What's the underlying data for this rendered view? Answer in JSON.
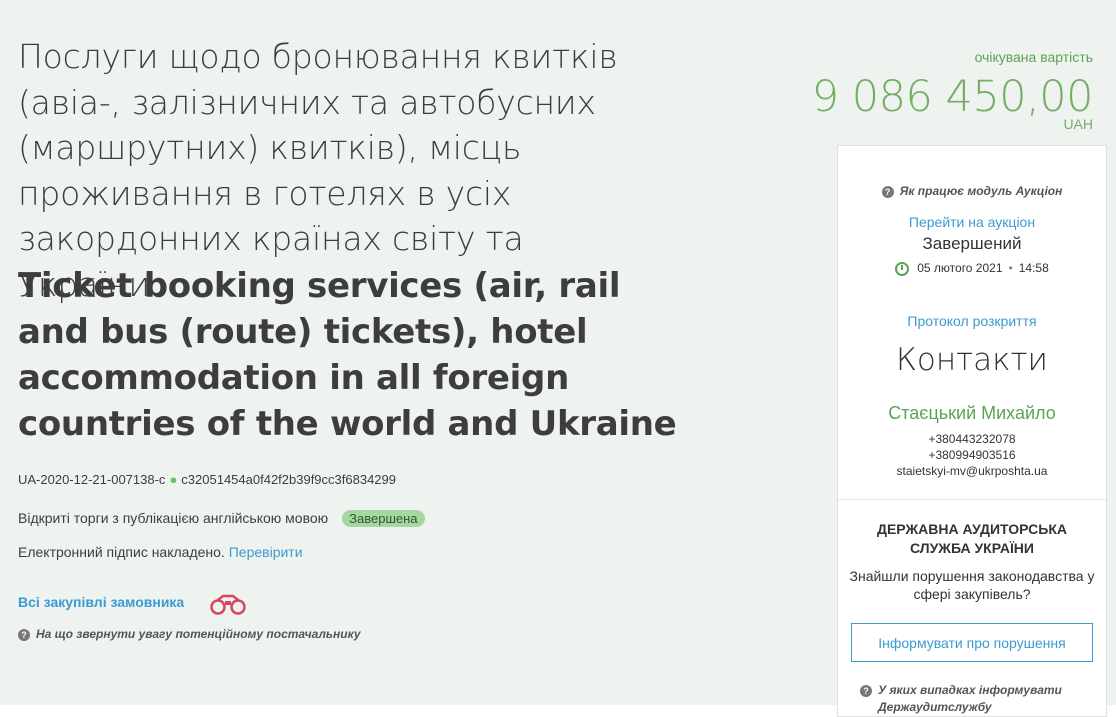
{
  "tender": {
    "title_uk": "Послуги щодо бронювання квитків (авіа-, залізничних та автобусних (маршрутних) квитків), місць проживання в готелях в усіх закордонних країнах світу та України",
    "title_en": "Ticket booking services (air, rail and bus (route) tickets), hotel accommodation in all foreign countries of the world and Ukraine",
    "id": "UA-2020-12-21-007138-c",
    "hash": "c32051454a0f42f2b39f9cc3f6834299",
    "procedure": "Відкриті торги з публікацією англійською мовою",
    "status": "Завершена",
    "signature_text": "Електронний підпис накладено.",
    "verify_link": "Перевірити",
    "all_purchases_link": "Всі закупівлі замовника",
    "supplier_note": "На що звернути увагу потенційному постачальнику"
  },
  "expected": {
    "label": "очікувана вартість",
    "value": "9 086 450,00",
    "currency": "UAH"
  },
  "auction": {
    "help": "Як працює модуль Аукціон",
    "link": "Перейти на аукціон",
    "status": "Завершений",
    "date": "05 лютого 2021",
    "time": "14:58",
    "protocol_link": "Протокол розкриття"
  },
  "contacts": {
    "title": "Контакти",
    "name": "Стаєцький Михайло",
    "phone1": "+380443232078",
    "phone2": "+380994903516",
    "email": "staietskyi-mv@ukrposhta.ua"
  },
  "audit": {
    "title": "ДЕРЖАВНА АУДИТОРСЬКА СЛУЖБА УКРАЇНИ",
    "question": "Знайшли порушення законодавства у сфері закупівель?",
    "button": "Інформувати про порушення",
    "help": "У яких випадках інформувати Держаудитслужбу"
  },
  "colors": {
    "background": "#eff3f0",
    "accent_green": "#75ad66",
    "link_blue": "#3a9bd0",
    "status_badge": "#a6d6a1"
  },
  "icons": [
    "help-icon",
    "binoculars-icon",
    "clock-icon"
  ]
}
